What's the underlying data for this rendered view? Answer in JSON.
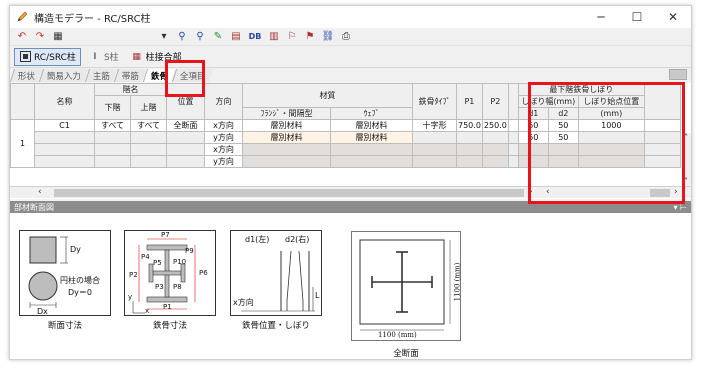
{
  "window": {
    "title": "構造モデラー - RC/SRC柱",
    "controls": [
      "─",
      "☐",
      "✕"
    ]
  },
  "toolbar2": {
    "rc_src_label": "RC/SRC柱",
    "s_label": "S柱",
    "joint_label": "柱接合部"
  },
  "toolbar1": {
    "db_label": "DB"
  },
  "tabs": [
    "形状",
    "簡易入力",
    "主筋",
    "帯筋",
    "鉄骨",
    "全項目"
  ],
  "active_tab": "鉄骨",
  "grid": {
    "headers": {
      "floor_group": "階名",
      "name": "名称",
      "lower": "下階",
      "upper": "上階",
      "position": "位置",
      "direction": "方向",
      "material_group": "材質",
      "flange": "ﾌﾗﾝｼﾞ・間隔型",
      "web": "ｳｪﾌﾞ",
      "type": "鉄骨ﾀｲﾌﾟ",
      "p1": "P1",
      "p2": "P2",
      "taper_group": "最下階鉄骨しぼり",
      "taper_width": "しぼり幅(mm)",
      "taper_start": "しぼり始点位置",
      "d1": "d1",
      "d2": "d2",
      "mm": "(mm)"
    },
    "row_number": "1",
    "rows": [
      {
        "name": "C1",
        "lower": "すべて",
        "upper": "すべて",
        "position": "全断面",
        "direction": "x方向",
        "flange": "層別材料",
        "web": "層別材料",
        "type": "十字形",
        "p1": "750.0",
        "p2": "250.0",
        "d1": "50",
        "d2": "50",
        "start": "1000"
      },
      {
        "name": "",
        "lower": "",
        "upper": "",
        "position": "",
        "direction": "y方向",
        "flange": "層別材料",
        "web": "層別材料",
        "type": "",
        "p1": "",
        "p2": "",
        "d1": "50",
        "d2": "50",
        "start": ""
      },
      {
        "name": "",
        "lower": "",
        "upper": "",
        "position": "",
        "direction": "x方向",
        "flange": "",
        "web": "",
        "type": "",
        "p1": "",
        "p2": "",
        "d1": "",
        "d2": "",
        "start": ""
      },
      {
        "name": "",
        "lower": "",
        "upper": "",
        "position": "",
        "direction": "y方向",
        "flange": "",
        "web": "",
        "type": "",
        "p1": "",
        "p2": "",
        "d1": "",
        "d2": "",
        "start": ""
      }
    ]
  },
  "panel": {
    "title": "部材断面図",
    "diagrams": {
      "section": {
        "caption": "断面寸法",
        "dy": "Dy",
        "dx": "Dx",
        "circle_note1": "円柱の場合",
        "circle_note2": "Dy＝0"
      },
      "steel": {
        "caption": "鉄骨寸法",
        "labels": [
          "P7",
          "P4",
          "P5",
          "P9",
          "P10",
          "P6",
          "P2",
          "P3",
          "P8",
          "P1",
          "y",
          "x"
        ]
      },
      "position": {
        "caption": "鉄骨位置・しぼり",
        "d1": "d1(左)",
        "d2": "d2(右)",
        "xdir": "x方向",
        "l": "L"
      },
      "full": {
        "caption": "全断面",
        "width": "1100 (mm)",
        "height": "1100 (mm)"
      }
    }
  }
}
